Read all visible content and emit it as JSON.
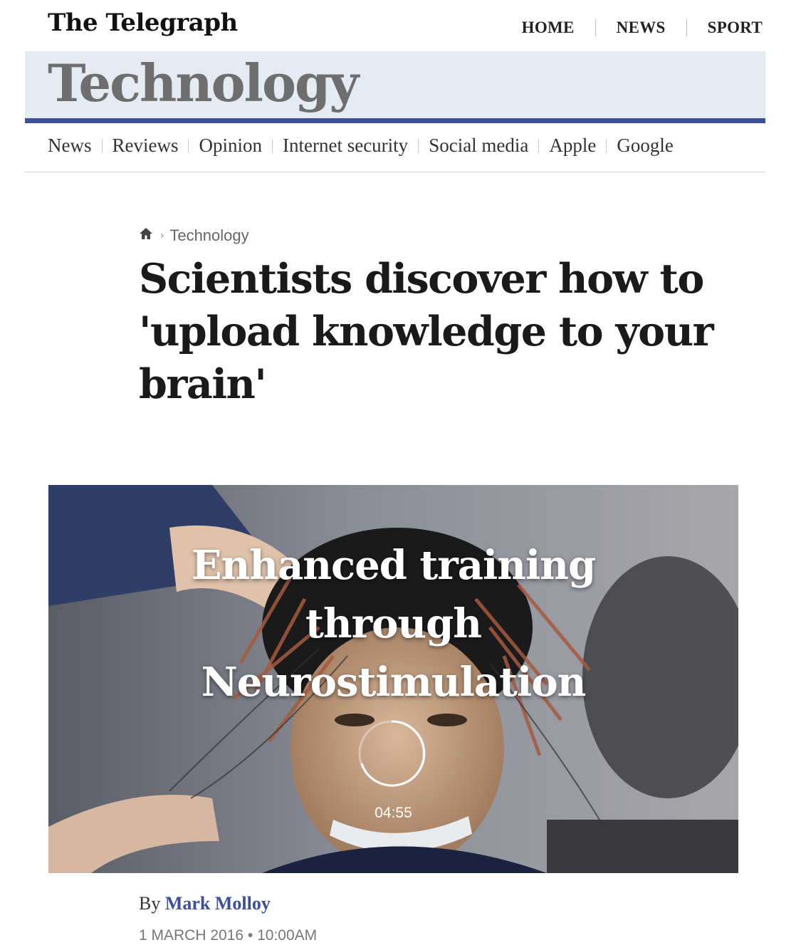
{
  "masthead": {
    "logo": "The Telegraph",
    "nav": [
      "HOME",
      "NEWS",
      "SPORT"
    ]
  },
  "section": {
    "title": "Technology"
  },
  "subnav": {
    "items": [
      "News",
      "Reviews",
      "Opinion",
      "Internet security",
      "Social media",
      "Apple",
      "Google"
    ]
  },
  "breadcrumb": {
    "home_icon": "home-icon",
    "section": "Technology"
  },
  "article": {
    "headline": "Scientists discover how to 'upload knowledge to your brain'",
    "video": {
      "title": "Enhanced training through Neurostimulation",
      "duration": "04:55"
    },
    "byline_prefix": "By",
    "author": "Mark Molloy",
    "date": "1 MARCH 2016 • 10:00AM"
  },
  "colors": {
    "brand_blue": "#3d4f9b",
    "section_band": "#e4ebf3"
  }
}
